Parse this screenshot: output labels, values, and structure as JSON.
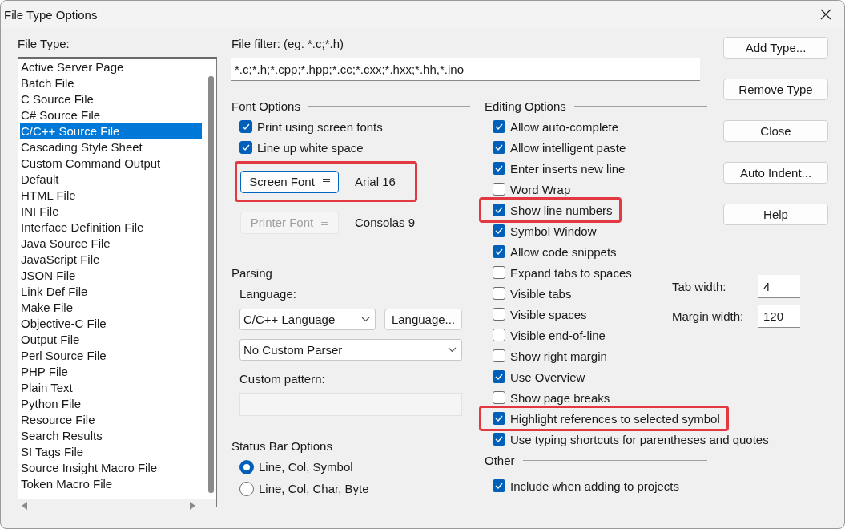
{
  "window": {
    "title": "File Type Options"
  },
  "file_type": {
    "label": "File Type:",
    "items": [
      {
        "label": "Active Server Page",
        "selected": false
      },
      {
        "label": "Batch File",
        "selected": false
      },
      {
        "label": "C Source File",
        "selected": false
      },
      {
        "label": "C# Source File",
        "selected": false
      },
      {
        "label": "C/C++ Source File",
        "selected": true
      },
      {
        "label": "Cascading Style Sheet",
        "selected": false
      },
      {
        "label": "Custom Command Output",
        "selected": false
      },
      {
        "label": "Default",
        "selected": false
      },
      {
        "label": "HTML File",
        "selected": false
      },
      {
        "label": "INI File",
        "selected": false
      },
      {
        "label": "Interface Definition File",
        "selected": false
      },
      {
        "label": "Java Source File",
        "selected": false
      },
      {
        "label": "JavaScript File",
        "selected": false
      },
      {
        "label": "JSON File",
        "selected": false
      },
      {
        "label": "Link Def File",
        "selected": false
      },
      {
        "label": "Make File",
        "selected": false
      },
      {
        "label": "Objective-C File",
        "selected": false
      },
      {
        "label": "Output File",
        "selected": false
      },
      {
        "label": "Perl Source File",
        "selected": false
      },
      {
        "label": "PHP File",
        "selected": false
      },
      {
        "label": "Plain Text",
        "selected": false
      },
      {
        "label": "Python File",
        "selected": false
      },
      {
        "label": "Resource File",
        "selected": false
      },
      {
        "label": "Search Results",
        "selected": false
      },
      {
        "label": "SI Tags File",
        "selected": false
      },
      {
        "label": "Source Insight Macro File",
        "selected": false
      },
      {
        "label": "Token Macro File",
        "selected": false
      }
    ]
  },
  "file_filter": {
    "label": "File filter: (eg. *.c;*.h)",
    "value": "*.c;*.h;*.cpp;*.hpp;*.cc;*.cxx;*.hxx;*.hh,*.ino"
  },
  "font_options": {
    "title": "Font Options",
    "checkboxes": [
      {
        "label": "Print using screen fonts",
        "checked": true,
        "highlighted": false
      },
      {
        "label": "Line up white space",
        "checked": true,
        "highlighted": false
      }
    ],
    "fonts": [
      {
        "button": "Screen Font",
        "value": "Arial 16",
        "disabled": false,
        "highlighted": true
      },
      {
        "button": "Printer Font",
        "value": "Consolas 9",
        "disabled": true,
        "highlighted": false
      }
    ]
  },
  "parsing": {
    "title": "Parsing",
    "language_label": "Language:",
    "language": "C/C++ Language",
    "language_button": "Language...",
    "parser": "No Custom Parser",
    "custom_pattern_label": "Custom pattern:"
  },
  "status_bar_options": {
    "title": "Status Bar Options",
    "radios": [
      {
        "label": "Line, Col, Symbol",
        "selected": true
      },
      {
        "label": "Line, Col, Char, Byte",
        "selected": false
      }
    ]
  },
  "editing_options": {
    "title": "Editing Options",
    "checkboxes": [
      {
        "label": "Allow auto-complete",
        "checked": true,
        "highlighted": false
      },
      {
        "label": "Allow intelligent paste",
        "checked": true,
        "highlighted": false
      },
      {
        "label": "Enter inserts new line",
        "checked": true,
        "highlighted": false
      },
      {
        "label": "Word Wrap",
        "checked": false,
        "highlighted": false
      },
      {
        "label": "Show line numbers",
        "checked": true,
        "highlighted": true
      },
      {
        "label": "Symbol Window",
        "checked": true,
        "highlighted": false
      },
      {
        "label": "Allow code snippets",
        "checked": true,
        "highlighted": false
      },
      {
        "label": "Expand tabs to spaces",
        "checked": false,
        "highlighted": false
      },
      {
        "label": "Visible tabs",
        "checked": false,
        "highlighted": false
      },
      {
        "label": "Visible spaces",
        "checked": false,
        "highlighted": false
      },
      {
        "label": "Visible end-of-line",
        "checked": false,
        "highlighted": false
      },
      {
        "label": "Show right margin",
        "checked": false,
        "highlighted": false
      },
      {
        "label": "Use Overview",
        "checked": true,
        "highlighted": false
      },
      {
        "label": "Show page breaks",
        "checked": false,
        "highlighted": false
      },
      {
        "label": "Highlight references to selected symbol",
        "checked": true,
        "highlighted": true
      },
      {
        "label": "Use typing shortcuts for parentheses and quotes",
        "checked": true,
        "highlighted": false
      }
    ],
    "fields": [
      {
        "label": "Tab width:",
        "value": "4"
      },
      {
        "label": "Margin width:",
        "value": "120"
      }
    ]
  },
  "other": {
    "title": "Other",
    "checkboxes": [
      {
        "label": "Include when adding to projects",
        "checked": true,
        "highlighted": false
      }
    ]
  },
  "buttons": [
    "Add Type...",
    "Remove Type",
    "Close",
    "Auto Indent...",
    "Help"
  ]
}
